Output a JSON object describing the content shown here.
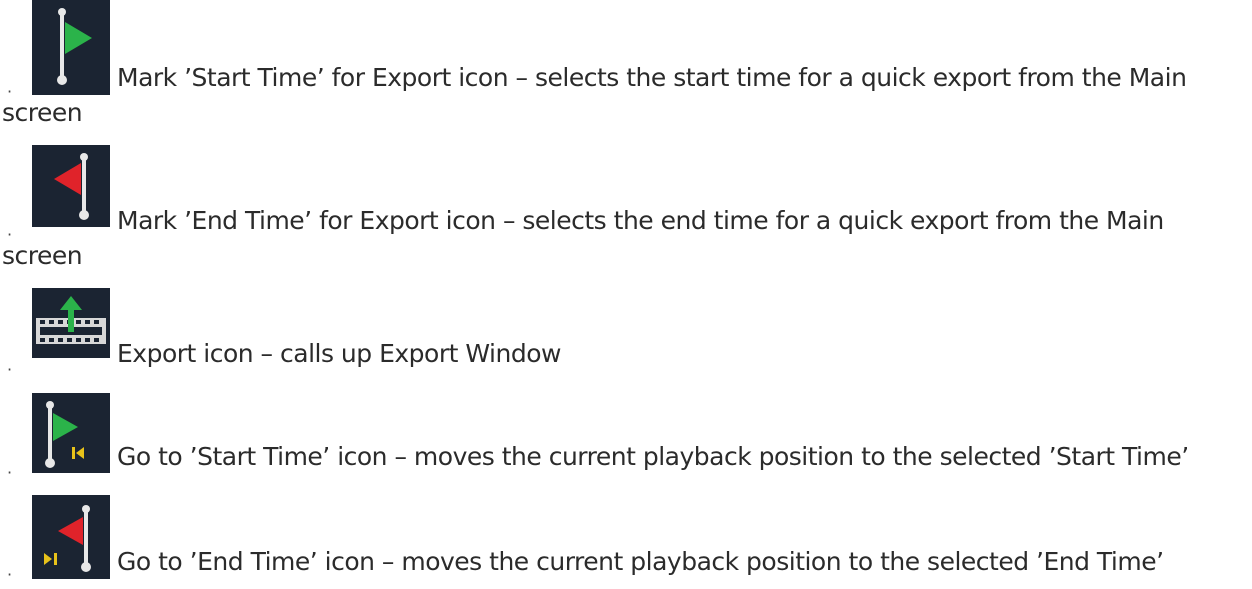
{
  "bullet": "·",
  "items": [
    {
      "icon": "flag-start-icon",
      "line1": "Mark ’Start Time’ for Export icon – selects the start time for a quick export from the Main",
      "line2": "screen"
    },
    {
      "icon": "flag-end-icon",
      "line1": "Mark ’End Time’ for Export icon – selects the end time for a quick export from the Main",
      "line2": "screen"
    },
    {
      "icon": "export-film-icon",
      "line1": "Export icon – calls up Export Window"
    },
    {
      "icon": "goto-start-icon",
      "line1": "Go to ’Start Time’ icon – moves the current playback position to the selected ’Start Time’"
    },
    {
      "icon": "goto-end-icon",
      "line1": "Go to ’End Time’ icon – moves the current playback position to the selected ’End Time’"
    }
  ],
  "colors": {
    "icon_bg": "#1b2432",
    "flag_green": "#2bb34a",
    "flag_red": "#e0232a",
    "pole": "#e8e8e8",
    "marker_yellow": "#e8c21a"
  }
}
